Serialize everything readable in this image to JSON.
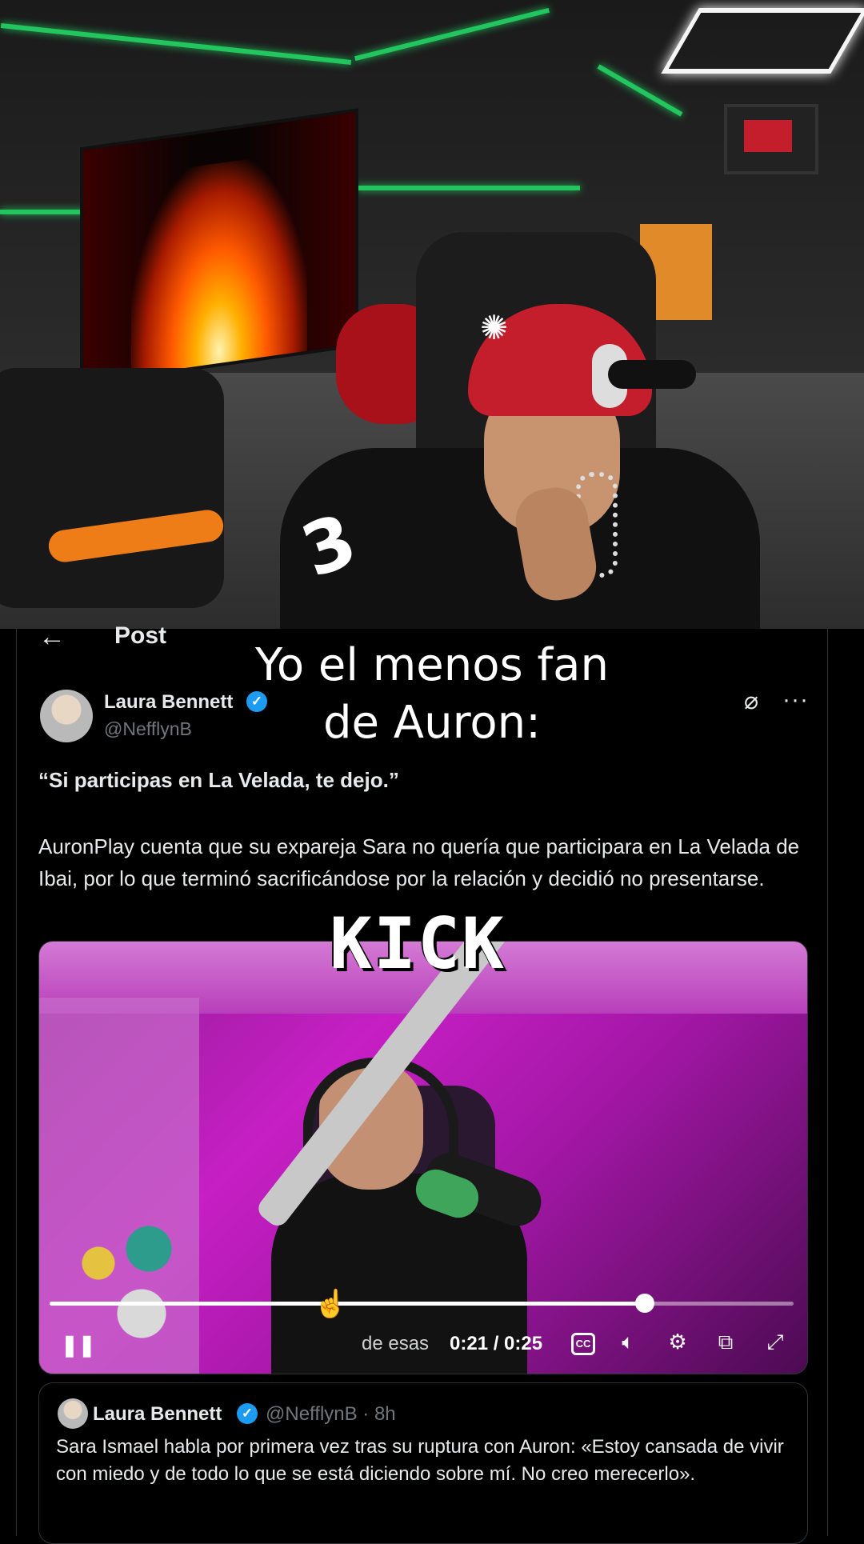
{
  "meme": {
    "caption_line1": "Yo el menos fan",
    "caption_line2": "de Auron:"
  },
  "header": {
    "back_icon": "arrow-left-icon",
    "title": "Post"
  },
  "post": {
    "author_name": "Laura Bennett",
    "author_handle": "@NefflynB",
    "quote": "“Si participas en La Velada, te dejo.”",
    "body": "AuronPlay cuenta que su expareja Sara no quería que participara en La Velada de Ibai, por lo que terminó sacrificándose por la relación y decidió no presentarse."
  },
  "video": {
    "overlay_logo": "KICK",
    "caption_fragment": "de esas",
    "time": "0:21 / 0:25",
    "progress_fraction": 0.8
  },
  "quoted_post": {
    "author_name": "Laura Bennett",
    "author_handle": "@NefflynB · 8h",
    "text": "Sara Ismael habla por primera vez tras su ruptura con Auron: «Estoy cansada de vivir con miedo y de todo lo que se está diciendo sobre mí. No creo merecerlo»."
  },
  "colors": {
    "verified": "#1d9bf0",
    "background": "#000000",
    "secondary_text": "#71767b"
  }
}
